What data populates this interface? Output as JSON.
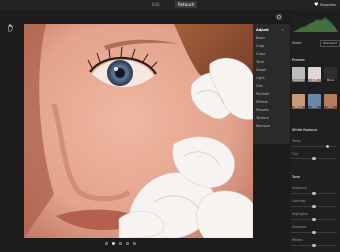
{
  "topbar": {
    "tabs": [
      "Edit",
      "Retouch"
    ],
    "favorites_label": "Favorites"
  },
  "canvas": {
    "pagination": {
      "total": 5,
      "active_index": 1
    }
  },
  "menu": {
    "header": "Adjust",
    "items": [
      "Basic",
      "Crop",
      "Color",
      "Tone",
      "Detail",
      "Light",
      "Film",
      "Portrait",
      "Effects",
      "Presets",
      "Texture",
      "Remove"
    ]
  },
  "panel": {
    "mode_label": "Mode",
    "mode_value": "Standard",
    "section_presets": "Presets",
    "thumbnails": [
      {
        "label": "Original",
        "color": "#bcbcbc"
      },
      {
        "label": "Soft",
        "color": "#e2d7d0"
      },
      {
        "label": "Mono",
        "color": "#2f2f2f"
      },
      {
        "label": "Warm",
        "color": "#c69a78"
      },
      {
        "label": "Cool",
        "color": "#6a88a9"
      },
      {
        "label": "Vivid",
        "color": "#b77a5a"
      }
    ],
    "section_white_balance": "White Balance",
    "wb_sliders": [
      {
        "label": "Temp",
        "value": 0.8
      },
      {
        "label": "Tint",
        "value": 0.5
      }
    ],
    "section_tone": "Tone",
    "tone_sliders": [
      {
        "label": "Exposure",
        "value": 0.5
      },
      {
        "label": "Contrast",
        "value": 0.5
      },
      {
        "label": "Highlights",
        "value": 0.5
      },
      {
        "label": "Shadows",
        "value": 0.5
      },
      {
        "label": "Whites",
        "value": 0.5
      }
    ]
  }
}
